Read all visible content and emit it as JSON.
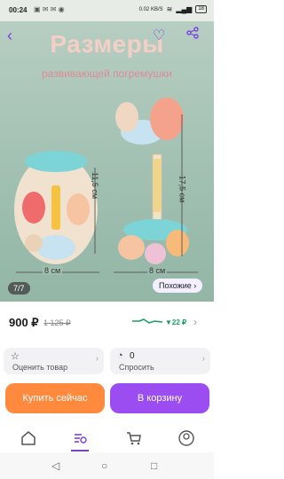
{
  "status_bar": {
    "time": "00:24",
    "speed": "0.02 KB/S",
    "battery": "18"
  },
  "gallery": {
    "title": "Размеры",
    "subtitle": "развивающей погремушки",
    "dim_height_left": "11,5 см",
    "dim_height_right": "17,5 см",
    "dim_width_left": "8 см",
    "dim_width_right": "8 см",
    "counter": "7/7",
    "similar_label": "Похожие ›"
  },
  "price": {
    "current": "900 ₽",
    "old": "1 125 ₽",
    "delta": "▼22 ₽"
  },
  "actions": {
    "rate_label": "Оценить товар",
    "ask_count": "0",
    "ask_label": "Спросить"
  },
  "buttons": {
    "buy_now": "Купить сейчас",
    "to_cart": "В корзину"
  },
  "colors": {
    "accent": "#9b4df2",
    "buy": "#ff8a3d",
    "green": "#1a9d62"
  },
  "icons": [
    "back-icon",
    "heart-icon",
    "share-icon",
    "home-icon",
    "catalog-icon",
    "cart-icon",
    "profile-icon"
  ]
}
